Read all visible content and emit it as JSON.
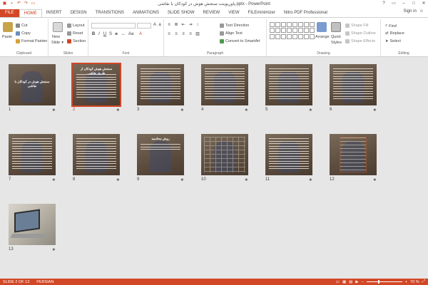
{
  "window": {
    "title": "پاورپوینت سنجش هوش در کودکان با نقاشی.pptx - PowerPoint",
    "sign_in": "Sign in"
  },
  "tabs": [
    {
      "label": "FILE"
    },
    {
      "label": "HOME"
    },
    {
      "label": "INSERT"
    },
    {
      "label": "DESIGN"
    },
    {
      "label": "TRANSITIONS"
    },
    {
      "label": "ANIMATIONS"
    },
    {
      "label": "SLIDE SHOW"
    },
    {
      "label": "REVIEW"
    },
    {
      "label": "VIEW"
    },
    {
      "label": "FILEminimizer"
    },
    {
      "label": "Nitro PDF Professional"
    }
  ],
  "ribbon": {
    "clipboard": {
      "label": "Clipboard",
      "paste": "Paste",
      "cut": "Cut",
      "copy": "Copy",
      "format_painter": "Format Painter"
    },
    "slides": {
      "label": "Slides",
      "new_slide": "New",
      "new_slide_2": "Slide",
      "layout": "Layout",
      "reset": "Reset",
      "section": "Section"
    },
    "font": {
      "label": "Font"
    },
    "paragraph": {
      "label": "Paragraph",
      "text_direction": "Text Direction",
      "align_text": "Align Text",
      "convert_smartart": "Convert to SmartArt"
    },
    "drawing": {
      "label": "Drawing",
      "arrange": "Arrange",
      "quick_styles": "Quick",
      "quick_styles_2": "Styles",
      "shape_fill": "Shape Fill",
      "shape_outline": "Shape Outline",
      "shape_effects": "Shape Effects"
    },
    "editing": {
      "label": "Editing",
      "find": "Find",
      "replace": "Replace",
      "select": "Select"
    }
  },
  "slides": [
    {
      "number": "1",
      "title": "سنجش هوش در کودکان با نقاشی"
    },
    {
      "number": "2",
      "title": "سنجش هوش كودكان از طريق نقاشی"
    },
    {
      "number": "3"
    },
    {
      "number": "4"
    },
    {
      "number": "5"
    },
    {
      "number": "6"
    },
    {
      "number": "7"
    },
    {
      "number": "8"
    },
    {
      "number": "9",
      "title": "روش محاسبه"
    },
    {
      "number": "10"
    },
    {
      "number": "11"
    },
    {
      "number": "12"
    },
    {
      "number": "13"
    }
  ],
  "status": {
    "slide_info": "SLIDE 2 OF 13",
    "language": "PERSIAN",
    "zoom": "70 %",
    "zoom_percent": 70
  },
  "colors": {
    "accent": "#d24726"
  }
}
